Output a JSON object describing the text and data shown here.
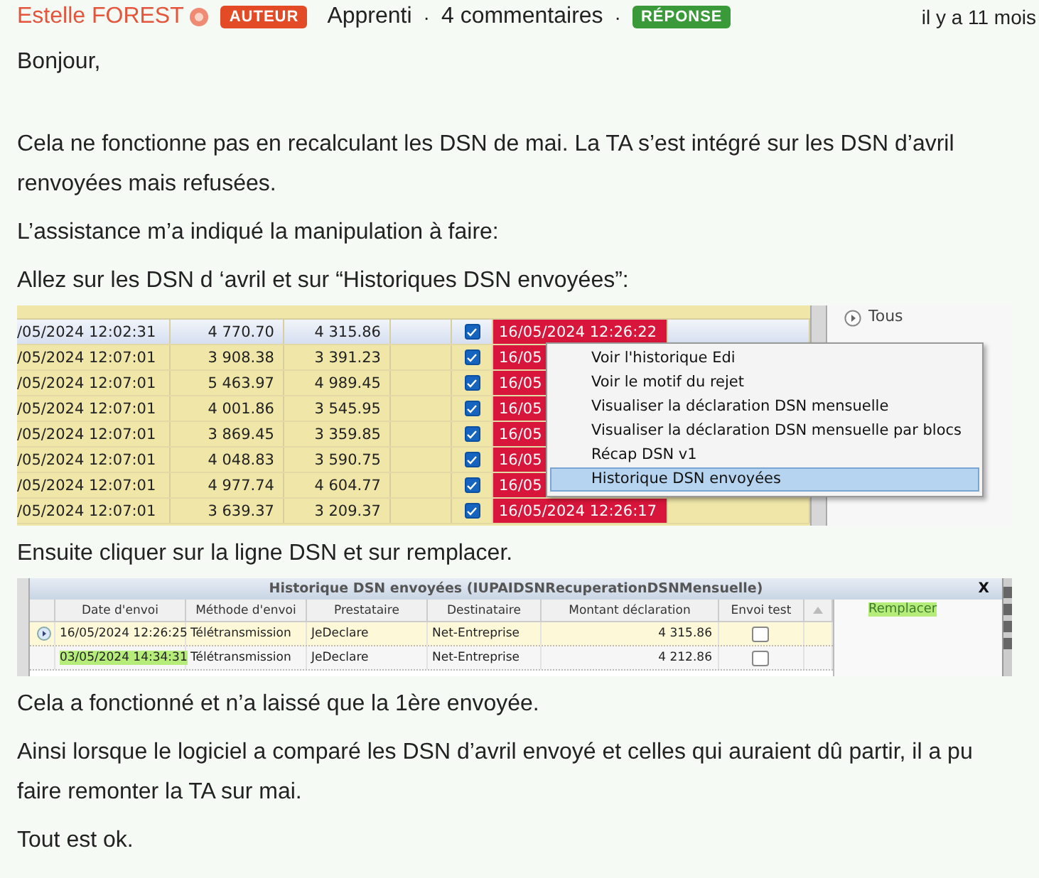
{
  "post": {
    "author": "Estelle FOREST",
    "author_badge": "AUTEUR",
    "rank": "Apprenti",
    "separator_1": "·",
    "comments": "4 commentaires",
    "separator_2": "·",
    "answer_badge": "RÉPONSE",
    "time": "il y a 11 mois"
  },
  "blocks": [
    {
      "kind": "paragraph",
      "text": "Bonjour,"
    },
    {
      "kind": "paragraph",
      "text": "Cela ne fonctionne pas en recalculant les DSN de mai. La TA s’est intégré sur les DSN d’avril renvoyées mais refusées."
    },
    {
      "kind": "paragraph",
      "text": "L’assistance m’a indiqué la manipulation à faire:"
    },
    {
      "kind": "paragraph",
      "text": "Allez sur les DSN d ‘avril et sur “Historiques DSN envoyées”:"
    },
    {
      "kind": "grid_shot",
      "side_item": "Tous",
      "rows": [
        {
          "date": "/05/2024 12:02:31",
          "amount_1": "4 770.70",
          "amount_2": "4 315.86",
          "checked": true,
          "sent": "16/05/2024 12:26:22",
          "selected": true
        },
        {
          "date": "/05/2024 12:07:01",
          "amount_1": "3 908.38",
          "amount_2": "3 391.23",
          "checked": true,
          "sent": "16/05",
          "selected": false
        },
        {
          "date": "/05/2024 12:07:01",
          "amount_1": "5 463.97",
          "amount_2": "4 989.45",
          "checked": true,
          "sent": "16/05",
          "selected": false
        },
        {
          "date": "/05/2024 12:07:01",
          "amount_1": "4 001.86",
          "amount_2": "3 545.95",
          "checked": true,
          "sent": "16/05",
          "selected": false
        },
        {
          "date": "/05/2024 12:07:01",
          "amount_1": "3 869.45",
          "amount_2": "3 359.85",
          "checked": true,
          "sent": "16/05",
          "selected": false
        },
        {
          "date": "/05/2024 12:07:01",
          "amount_1": "4 048.83",
          "amount_2": "3 590.75",
          "checked": true,
          "sent": "16/05",
          "selected": false
        },
        {
          "date": "/05/2024 12:07:01",
          "amount_1": "4 977.74",
          "amount_2": "4 604.77",
          "checked": true,
          "sent": "16/05",
          "selected": false
        },
        {
          "date": "/05/2024 12:07:01",
          "amount_1": "3 639.37",
          "amount_2": "3 209.37",
          "checked": true,
          "sent": "16/05/2024 12:26:17",
          "selected": false
        }
      ],
      "menu": [
        {
          "label": "Voir l'historique Edi",
          "selected": false
        },
        {
          "label": "Voir le motif du rejet",
          "selected": false
        },
        {
          "label": "Visualiser la déclaration DSN mensuelle",
          "selected": false
        },
        {
          "label": "Visualiser la déclaration DSN mensuelle par blocs",
          "selected": false
        },
        {
          "label": "Récap DSN v1",
          "selected": false
        },
        {
          "label": "Historique DSN envoyées",
          "selected": true
        }
      ]
    },
    {
      "kind": "paragraph",
      "text": "Ensuite cliquer sur la ligne DSN et sur remplacer."
    },
    {
      "kind": "history_shot",
      "title": "Historique DSN envoyées (IUPAIDSNRecuperationDSNMensuelle)",
      "close": "X",
      "columns": [
        "Date d'envoi",
        "Méthode d'envoi",
        "Prestataire",
        "Destinataire",
        "Montant déclaration",
        "Envoi test"
      ],
      "rows": [
        {
          "date": "16/05/2024 12:26:25",
          "method": "Télétransmission",
          "provider": "JeDeclare",
          "recipient": "Net-Entreprise",
          "amount": "4 315.86",
          "test": false,
          "selected": true,
          "highlighted": false
        },
        {
          "date": "03/05/2024 14:34:31",
          "method": "Télétransmission",
          "provider": "JeDeclare",
          "recipient": "Net-Entreprise",
          "amount": "4 212.86",
          "test": false,
          "selected": false,
          "highlighted": true
        }
      ],
      "action": {
        "label": "Remplacer",
        "highlighted": true
      }
    },
    {
      "kind": "paragraph",
      "text": "Cela a fonctionné et n’a laissé que la 1ère envoyée."
    },
    {
      "kind": "paragraph",
      "text": "Ainsi lorsque le logiciel a comparé les DSN d’avril envoyé et celles qui auraient dû partir, il a pu faire remonter la TA sur mai."
    },
    {
      "kind": "paragraph",
      "text": "Tout est ok."
    }
  ]
}
